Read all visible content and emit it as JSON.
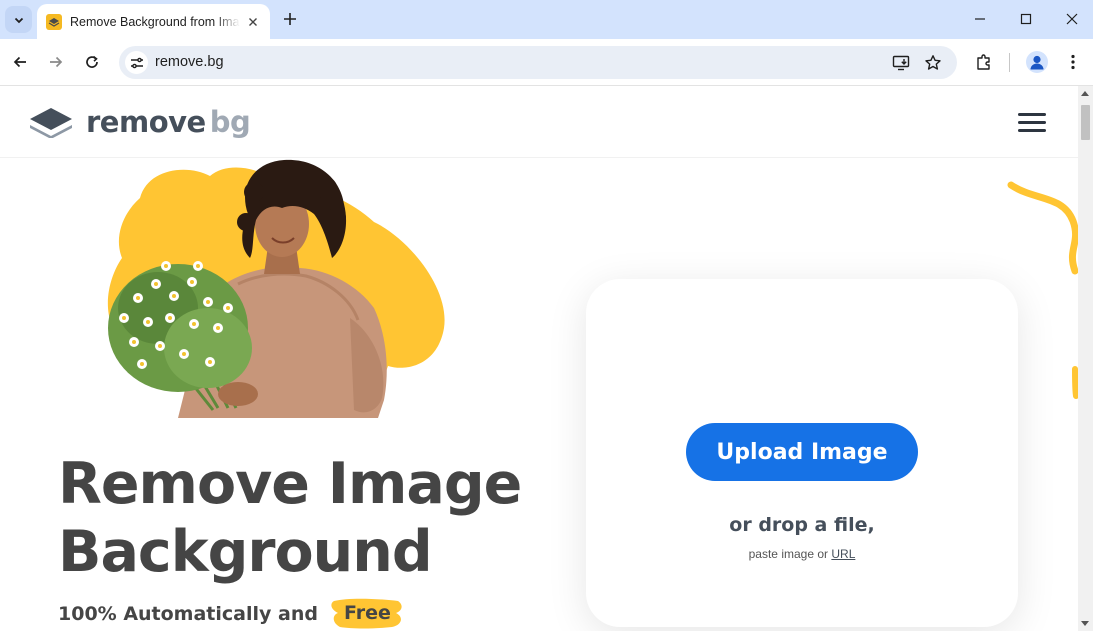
{
  "browser": {
    "tab_title": "Remove Background from Image",
    "url": "remove.bg"
  },
  "site": {
    "logo_main": "remove",
    "logo_accent": "bg"
  },
  "hero": {
    "headline_line1": "Remove Image",
    "headline_line2": "Background",
    "subline": "100% Automatically and",
    "free_label": "Free"
  },
  "upload": {
    "button_label": "Upload Image",
    "drop_text": "or drop a file,",
    "paste_text": "paste image or",
    "url_link": "URL"
  },
  "colors": {
    "brand_blue": "#1672e6",
    "accent_yellow": "#ffc533",
    "chrome_tabstrip": "#d3e3fd"
  }
}
